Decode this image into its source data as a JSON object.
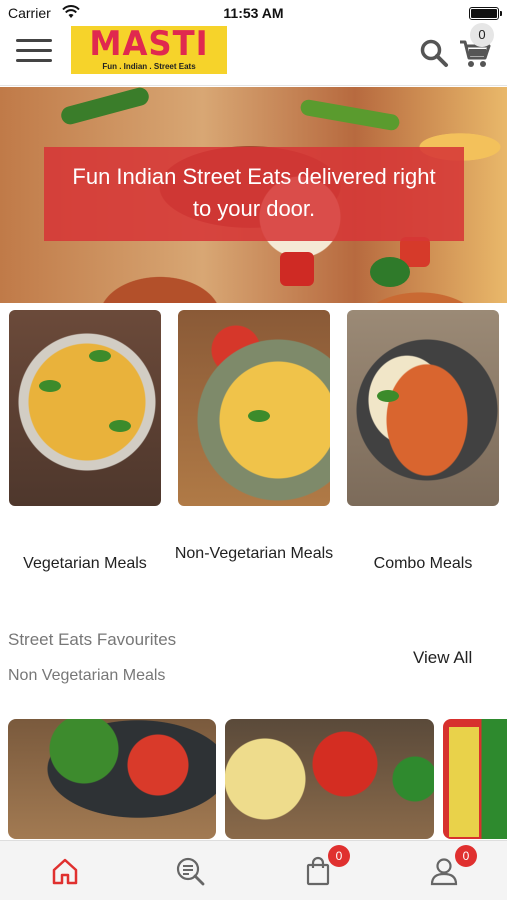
{
  "status_bar": {
    "carrier": "Carrier",
    "time": "11:53 AM"
  },
  "header": {
    "logo_text": "MASTI",
    "logo_tagline": "Fun . Indian . Street Eats",
    "cart_count": "0",
    "icons": [
      "menu-icon",
      "search-icon",
      "cart-icon"
    ]
  },
  "hero": {
    "text": "Fun Indian Street Eats delivered right to your door."
  },
  "categories": [
    {
      "label": "Vegetarian Meals"
    },
    {
      "label": "Non-Vegetarian Meals"
    },
    {
      "label": "Combo Meals"
    }
  ],
  "favourites": {
    "title": "Street Eats Favourites",
    "subtitle": "Non Vegetarian Meals",
    "view_all": "View All"
  },
  "tab_bar": {
    "tabs": [
      "home-icon",
      "search-list-icon",
      "bag-icon",
      "profile-icon"
    ],
    "bag_badge": "0",
    "profile_badge": "0",
    "active_color": "#e0302f"
  },
  "colors": {
    "accent": "#e0302f",
    "logo_bg": "#f6d32a",
    "logo_text": "#e0294f",
    "banner_bg": "#d63737"
  }
}
